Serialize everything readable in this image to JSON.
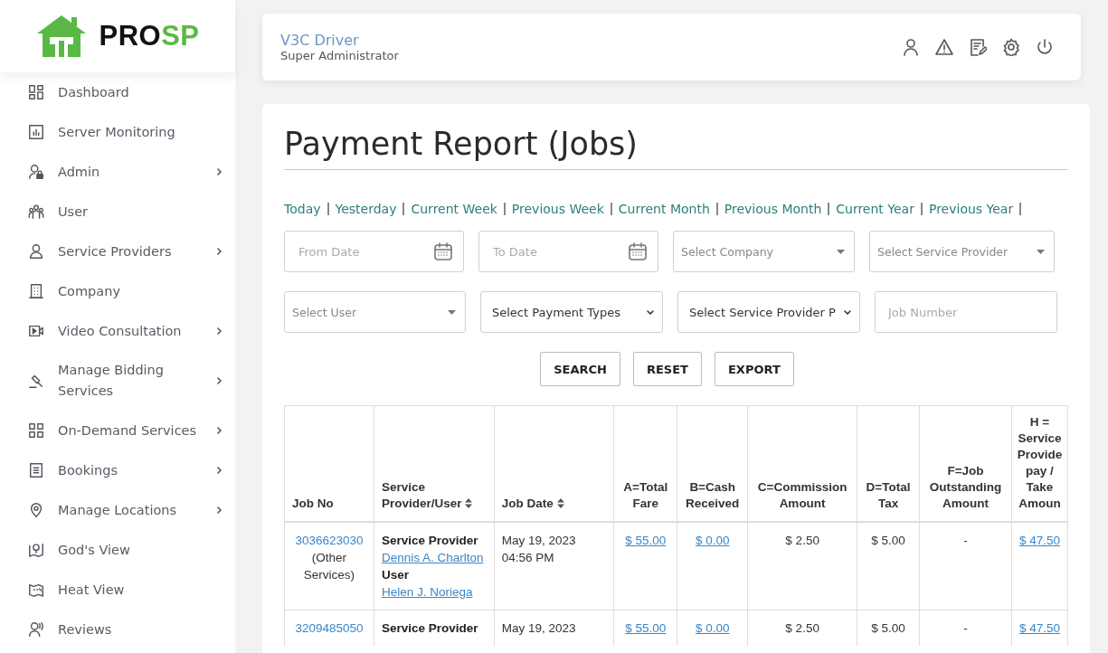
{
  "logo": {
    "text_dark": "PRO",
    "text_accent": "SP"
  },
  "sidebar": {
    "items": [
      {
        "label": "Dashboard",
        "has_submenu": false
      },
      {
        "label": "Server Monitoring",
        "has_submenu": false
      },
      {
        "label": "Admin",
        "has_submenu": true
      },
      {
        "label": "User",
        "has_submenu": false
      },
      {
        "label": "Service Providers",
        "has_submenu": true
      },
      {
        "label": "Company",
        "has_submenu": false
      },
      {
        "label": "Video Consultation",
        "has_submenu": true
      },
      {
        "label": "Manage Bidding Services",
        "has_submenu": true
      },
      {
        "label": "On-Demand Services",
        "has_submenu": true
      },
      {
        "label": "Bookings",
        "has_submenu": true
      },
      {
        "label": "Manage Locations",
        "has_submenu": true
      },
      {
        "label": "God's View",
        "has_submenu": false
      },
      {
        "label": "Heat View",
        "has_submenu": false
      },
      {
        "label": "Reviews",
        "has_submenu": false
      }
    ]
  },
  "header": {
    "user_name": "V3C Driver",
    "role": "Super Administrator"
  },
  "page": {
    "title": "Payment Report (Jobs)",
    "date_ranges": [
      "Today",
      "Yesterday",
      "Current Week",
      "Previous Week",
      "Current Month",
      "Previous Month",
      "Current Year",
      "Previous Year"
    ],
    "filters": [
      {
        "kind": "date",
        "placeholder": "From Date"
      },
      {
        "kind": "date",
        "placeholder": "To Date"
      },
      {
        "kind": "select",
        "placeholder": "Select Company"
      },
      {
        "kind": "select",
        "placeholder": "Select Service Provider"
      },
      {
        "kind": "select",
        "placeholder": "Select User"
      },
      {
        "kind": "dropdown",
        "value": "Select Payment Types"
      },
      {
        "kind": "dropdown",
        "value": "Select Service Provider P"
      },
      {
        "kind": "text",
        "placeholder": "Job Number"
      }
    ],
    "buttons": [
      "SEARCH",
      "RESET",
      "EXPORT"
    ],
    "table": {
      "columns": [
        {
          "label": "Job No",
          "sortable": false
        },
        {
          "label": "Service Provider/User",
          "sortable": true
        },
        {
          "label": "Job Date",
          "sortable": true
        },
        {
          "label": "A=Total Fare",
          "sortable": false
        },
        {
          "label": "B=Cash Received",
          "sortable": false
        },
        {
          "label": "C=Commission Amount",
          "sortable": false
        },
        {
          "label": "D=Total Tax",
          "sortable": false
        },
        {
          "label": "F=Job Outstanding Amount",
          "sortable": false
        },
        {
          "label": "H = Service Provide pay / Take Amoun",
          "sortable": false
        }
      ],
      "rows": [
        {
          "job_no": "3036623030",
          "job_type": "(Other Services)",
          "provider_label": "Service Provider",
          "provider": "Dennis A. Charlton",
          "user_label": "User",
          "user": "Helen J. Noriega",
          "date": "May 19, 2023",
          "time": "04:56 PM",
          "total_fare": "$ 55.00",
          "cash_received": "$ 0.00",
          "commission": "$ 2.50",
          "tax": "$ 5.00",
          "outstanding": "-",
          "provider_pay": "$ 47.50"
        },
        {
          "job_no": "3209485050",
          "provider_label": "Service Provider",
          "date": "May 19, 2023",
          "total_fare": "$ 55.00",
          "cash_received": "$ 0.00",
          "commission": "$ 2.50",
          "tax": "$ 5.00",
          "outstanding": "-",
          "provider_pay": "$ 47.50"
        }
      ]
    }
  }
}
